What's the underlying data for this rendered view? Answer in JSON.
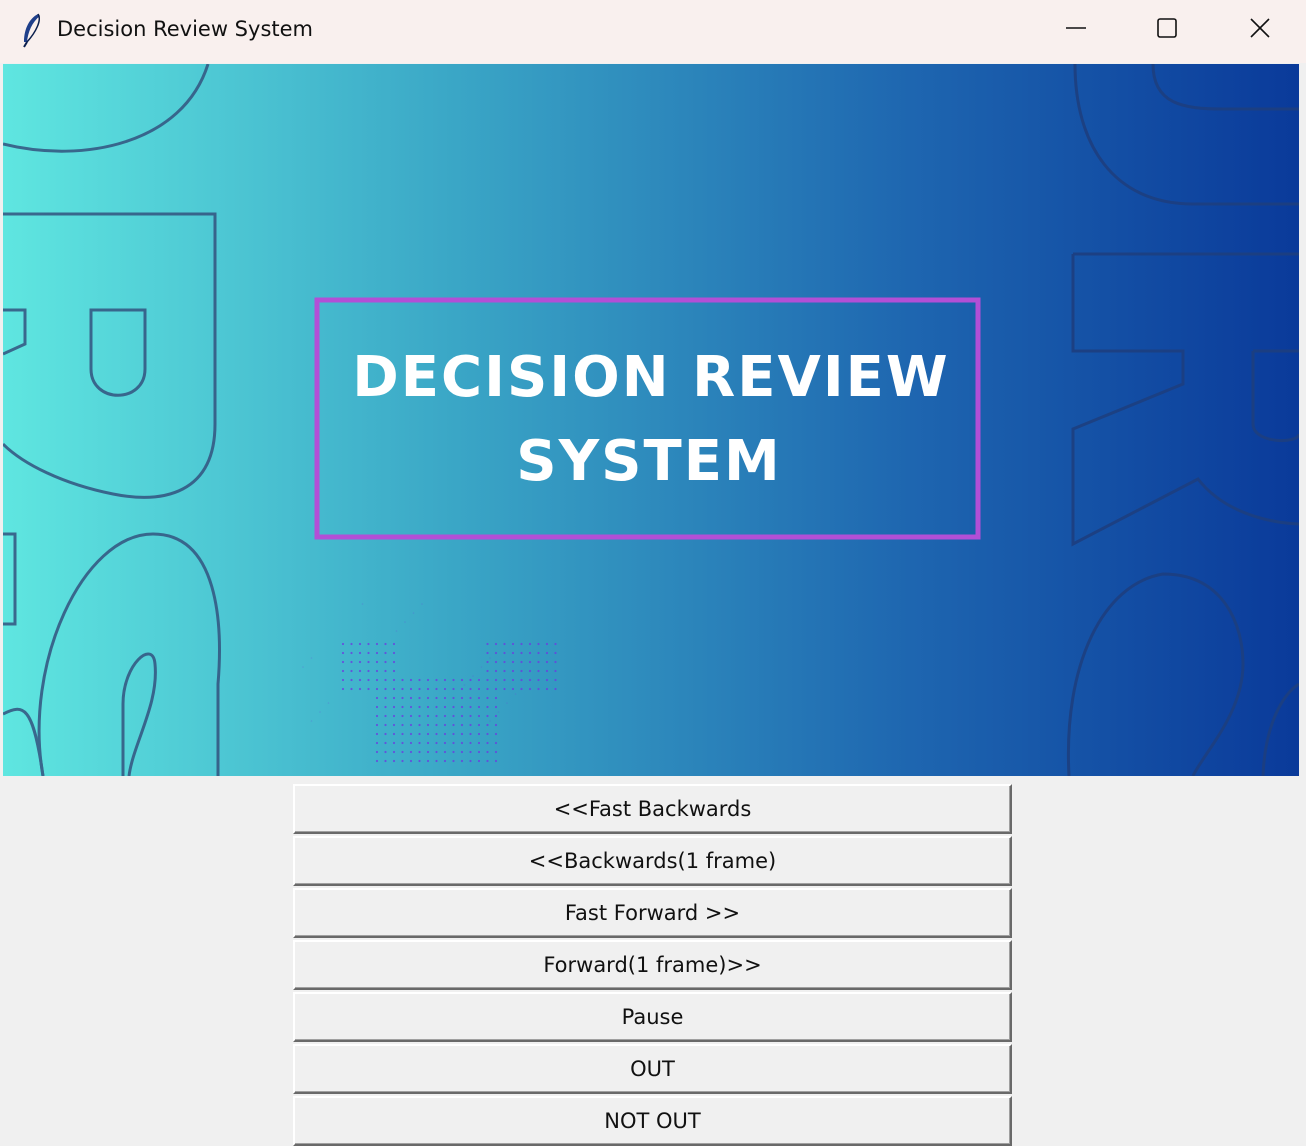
{
  "window": {
    "title": "Decision Review System",
    "icon": "feather-icon"
  },
  "banner": {
    "title_line1": "DECISION REVIEW",
    "title_line2": "SYSTEM",
    "gradient_start": "#5fe6e0",
    "gradient_end": "#0a3a9a",
    "frame_color": "#b24fd6"
  },
  "controls": {
    "fast_backwards": "<<Fast Backwards",
    "backwards_one": "<<Backwards(1 frame)",
    "fast_forward": "Fast Forward >>",
    "forward_one": "Forward(1 frame)>>",
    "pause": "Pause",
    "out": "OUT",
    "not_out": "NOT OUT"
  }
}
